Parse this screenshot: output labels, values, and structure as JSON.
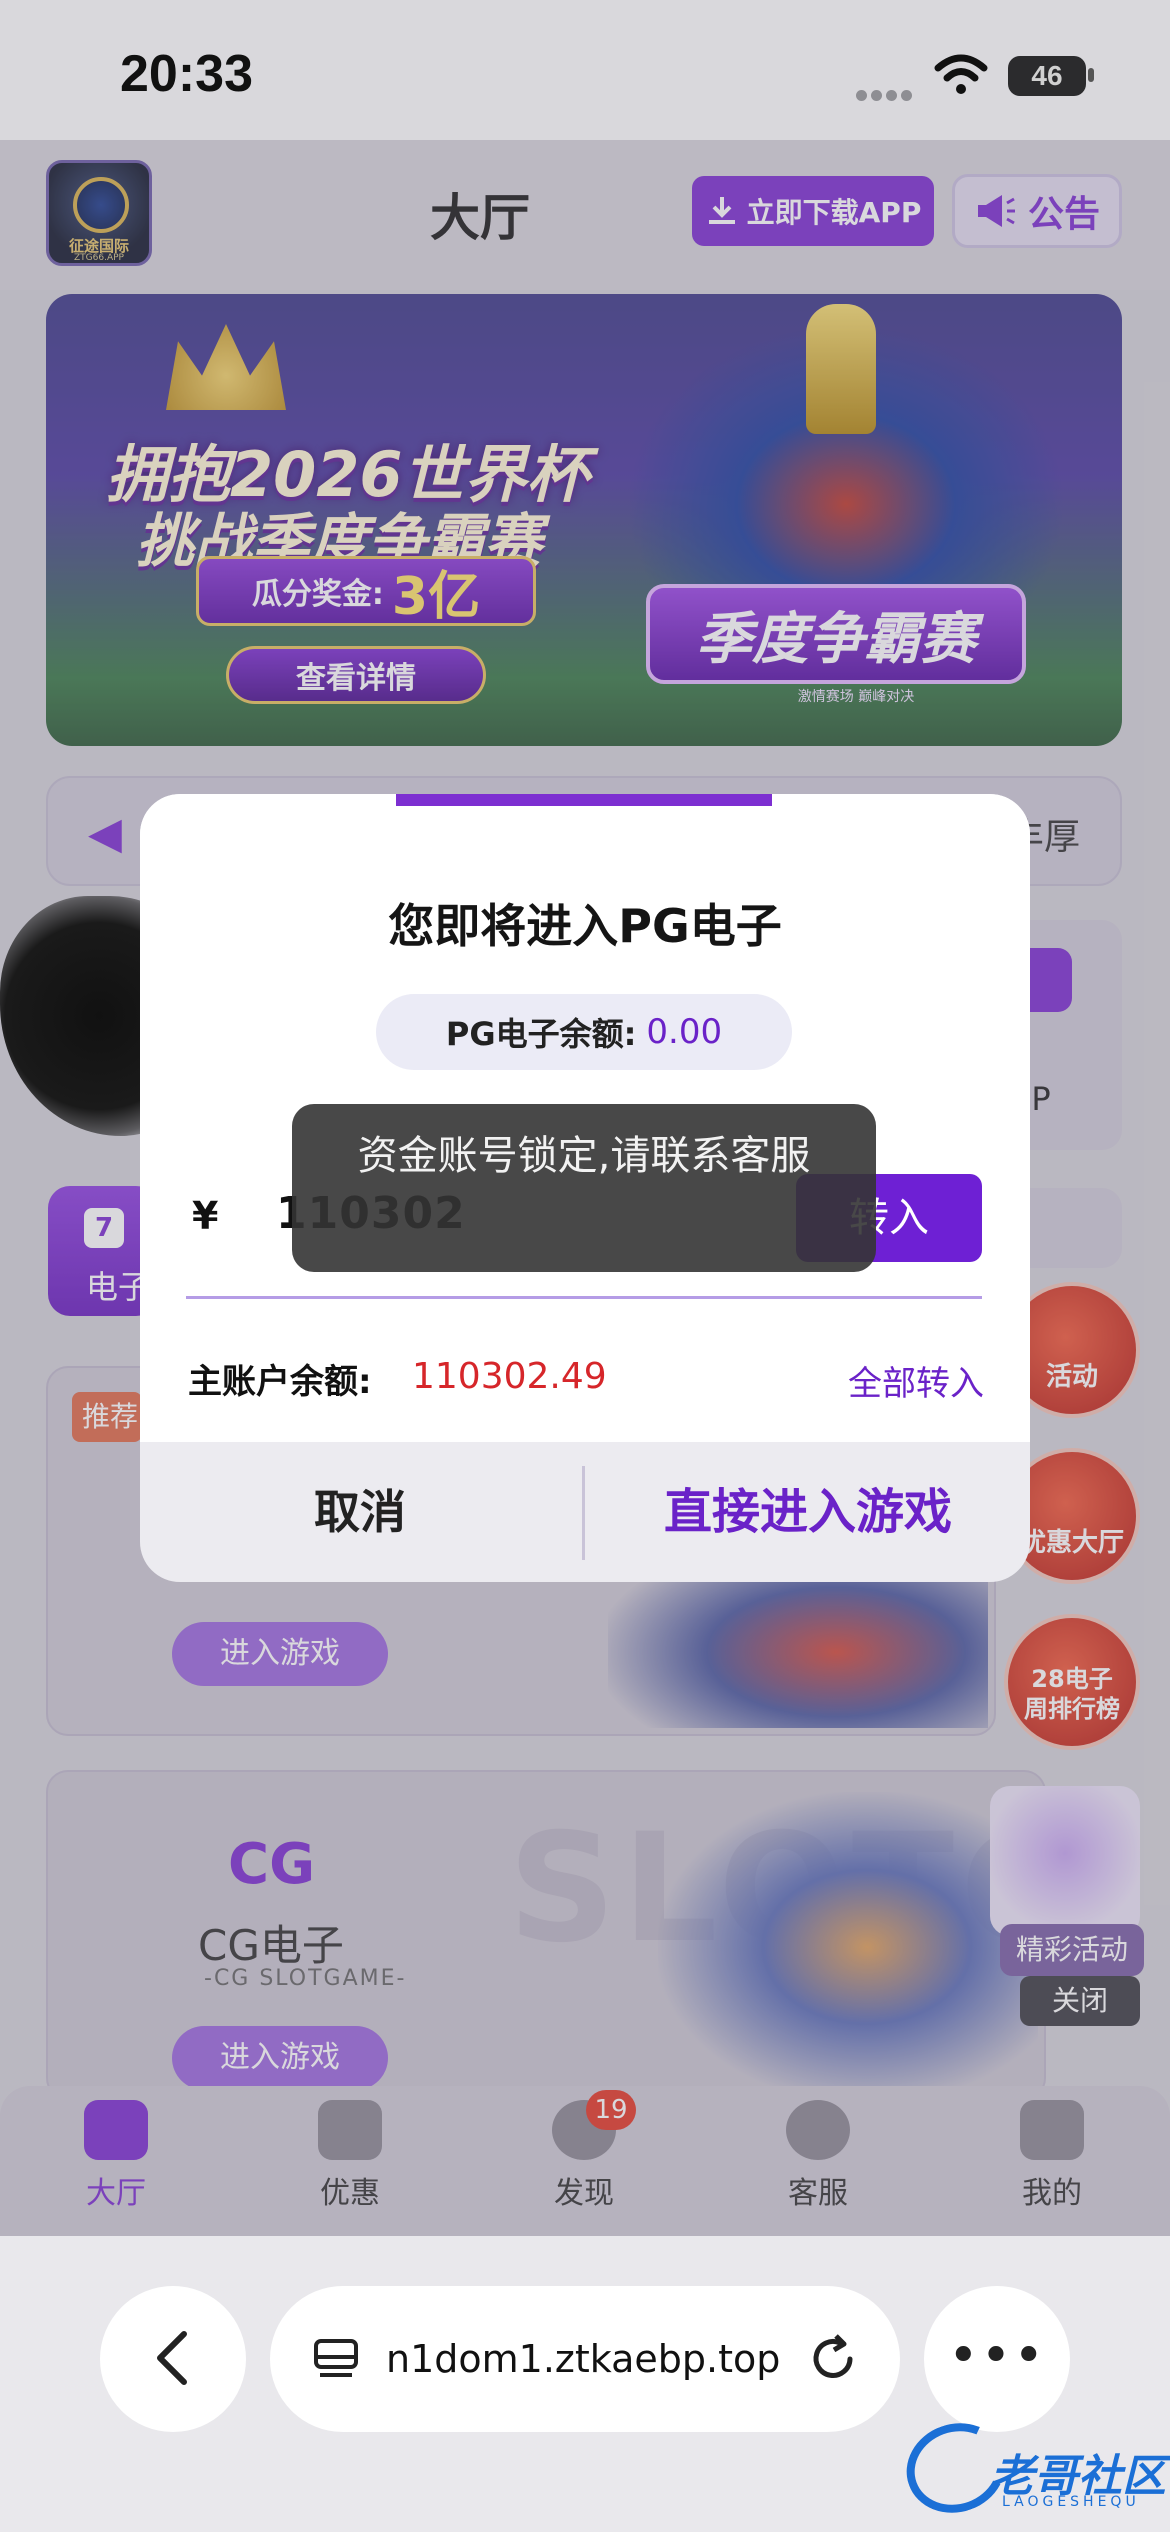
{
  "status_bar": {
    "time": "20:33",
    "battery": "46"
  },
  "header": {
    "title": "大厅",
    "logo_text": "征途国际",
    "logo_sub": "ZTG66.APP",
    "download_label": "立即下载APP",
    "notice_label": "公告"
  },
  "banner": {
    "line1": "拥抱2026世界杯",
    "line2": "挑战季度争霸赛",
    "prize_label": "瓜分奖金:",
    "prize_value": "3亿",
    "detail_button": "查看详情",
    "season_title": "季度争霸赛",
    "season_sub": "激情赛场 巅峰对决"
  },
  "marquee": {
    "text_tail": "丰厚"
  },
  "vip": {
    "label": "VIP"
  },
  "left_tab": {
    "num": "7",
    "label": "电子"
  },
  "cards": [
    {
      "tag": "推荐",
      "enter_label": "进入游戏"
    },
    {
      "logo": "CG",
      "title": "CG电子",
      "subtitle": "-CG SLOTGAME-",
      "enter_label": "进入游戏",
      "bg_text": "SLOTGAME"
    }
  ],
  "floating": [
    {
      "label": "活动"
    },
    {
      "label": "优惠大厅"
    },
    {
      "label": "28电子\n周排行榜"
    }
  ],
  "gift": {
    "label": "精彩活动",
    "close": "关闭"
  },
  "tabbar": {
    "items": [
      {
        "label": "大厅",
        "icon": "home-icon",
        "active": true
      },
      {
        "label": "优惠",
        "icon": "star-icon",
        "active": false
      },
      {
        "label": "发现",
        "icon": "compass-icon",
        "active": false
      },
      {
        "label": "客服",
        "icon": "chat-icon",
        "active": false
      },
      {
        "label": "我的",
        "icon": "user-icon",
        "active": false
      }
    ],
    "discover_badge": "19"
  },
  "modal": {
    "title": "您即将进入PG电子",
    "pg_balance_label": "PG电子余额:",
    "pg_balance_value": "0.00",
    "currency": "¥",
    "amount": "110302",
    "transfer_button": "转入",
    "main_balance_label": "主账户余额:",
    "main_balance_value": "110302.49",
    "transfer_all": "全部转入",
    "cancel": "取消",
    "enter_game": "直接进入游戏"
  },
  "toast": {
    "message": "资金账号锁定,请联系客服"
  },
  "browser": {
    "url": "n1dom1.ztkaebp.top"
  },
  "watermark": {
    "main": "老哥社区",
    "sub": "LAOGESHEQU"
  },
  "colors": {
    "accent": "#7d2fd1",
    "danger": "#d6262a",
    "toast_bg": "#343434"
  }
}
